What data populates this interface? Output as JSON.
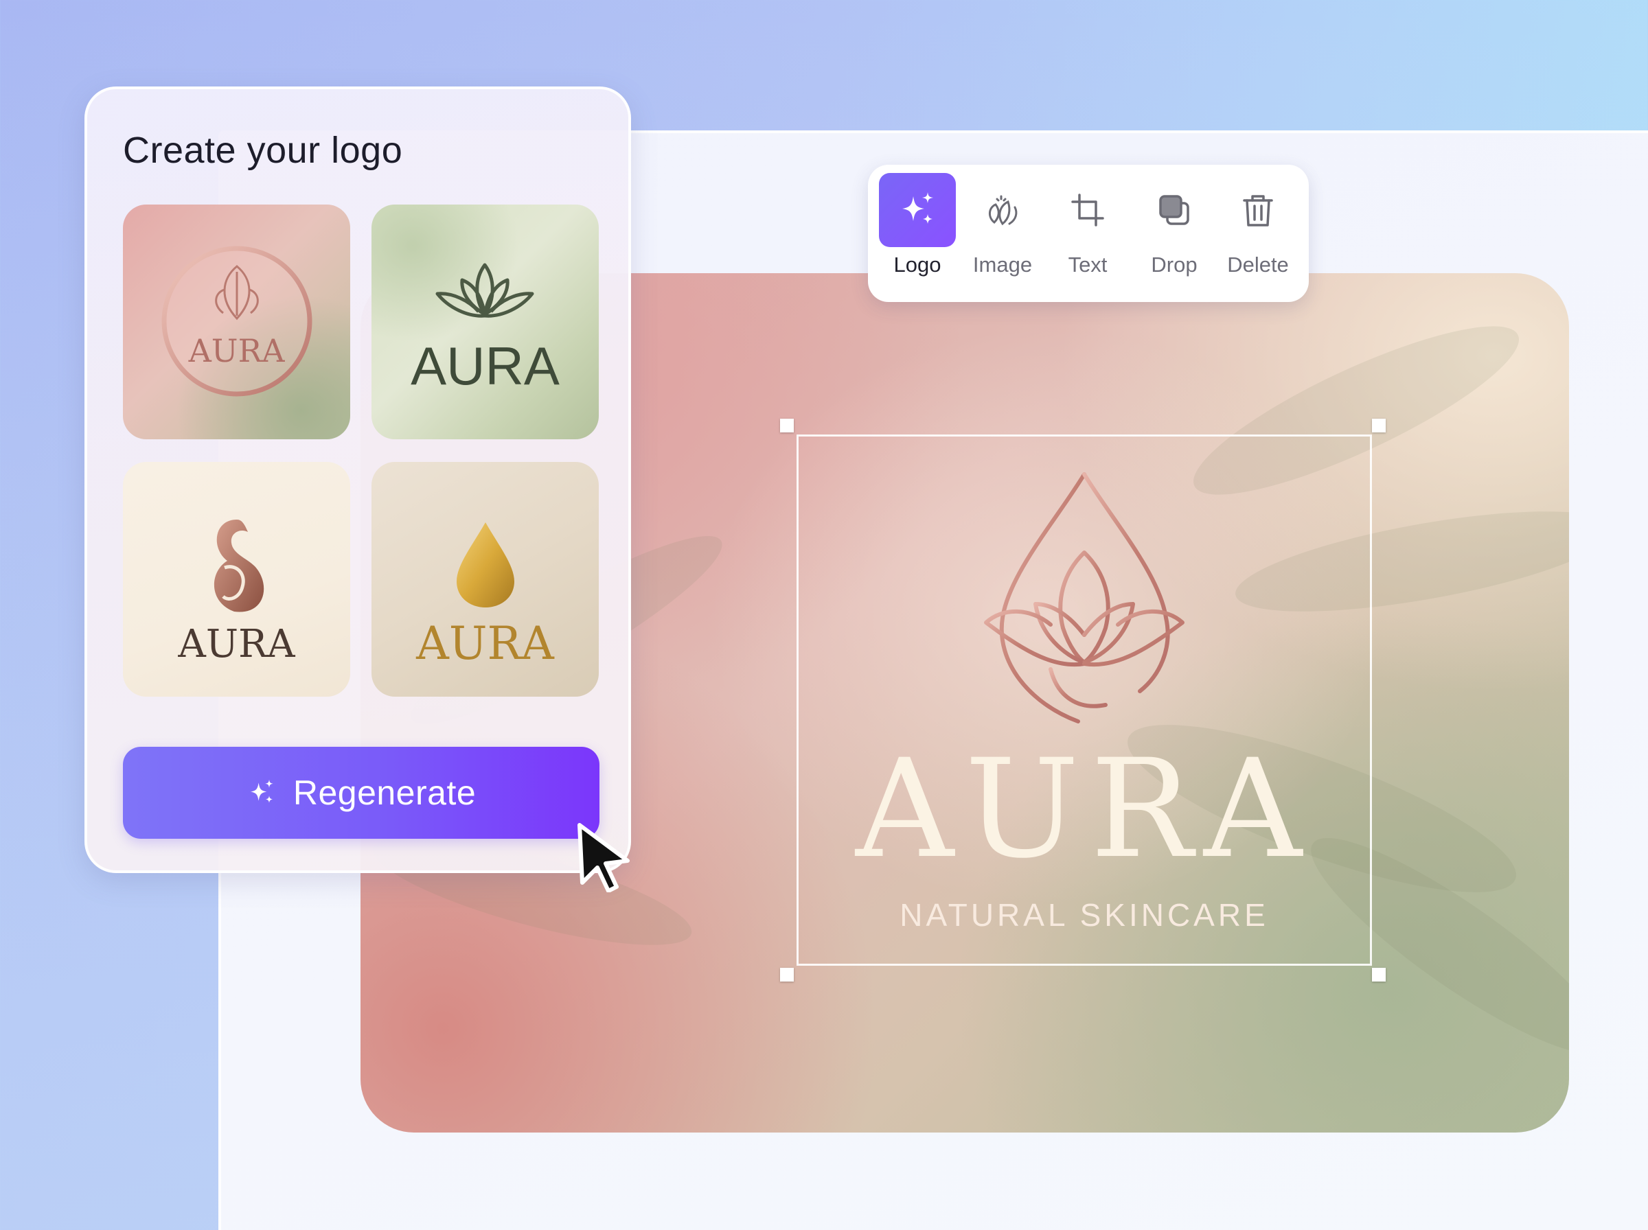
{
  "logo_panel": {
    "title": "Create your logo",
    "options": [
      {
        "wordmark": "AURA",
        "style": "rose-gold circle leaf emblem"
      },
      {
        "wordmark": "AURA",
        "style": "green lotus outline"
      },
      {
        "wordmark": "AURA",
        "style": "copper swirl drop"
      },
      {
        "wordmark": "AURA",
        "style": "gold foil drop"
      }
    ],
    "regenerate_label": "Regenerate",
    "regenerate_icon": "sparkles-icon"
  },
  "toolbar": {
    "tools": [
      {
        "label": "Logo",
        "icon": "sparkles-icon",
        "active": true
      },
      {
        "label": "Image",
        "icon": "leaf-image-icon",
        "active": false
      },
      {
        "label": "Text",
        "icon": "crop-icon",
        "active": false
      },
      {
        "label": "Drop",
        "icon": "drop-shadow-icon",
        "active": false
      },
      {
        "label": "Delete",
        "icon": "trash-icon",
        "active": false
      }
    ]
  },
  "canvas": {
    "brand_name": "AURA",
    "tagline": "NATURAL SKINCARE"
  },
  "colors": {
    "accent": "#7a5bf9",
    "rose_gold": "#c98a80",
    "wordmark_cream": "#fbf3e4"
  }
}
